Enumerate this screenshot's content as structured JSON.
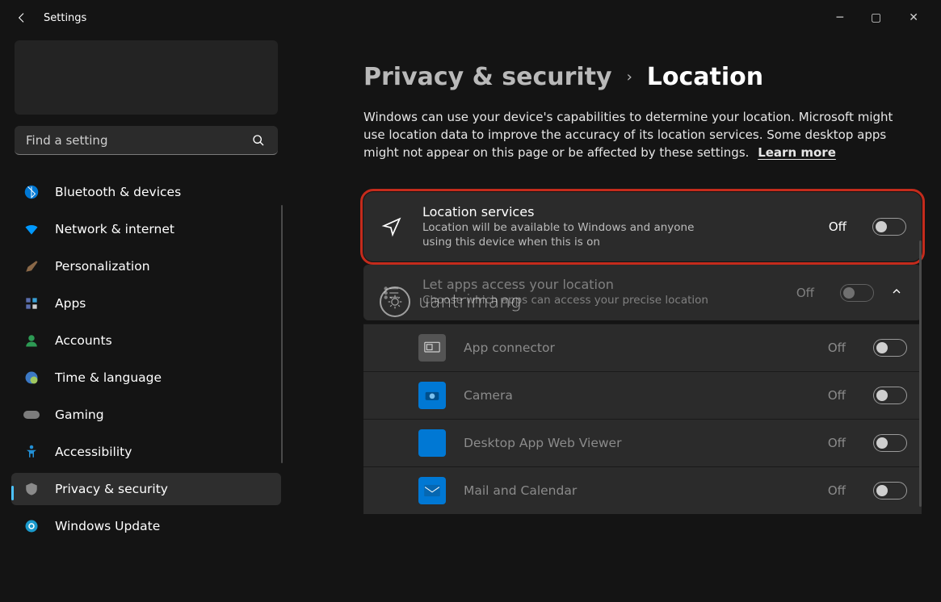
{
  "app_title": "Settings",
  "search_placeholder": "Find a setting",
  "sidebar": {
    "items": [
      {
        "label": "Bluetooth & devices"
      },
      {
        "label": "Network & internet"
      },
      {
        "label": "Personalization"
      },
      {
        "label": "Apps"
      },
      {
        "label": "Accounts"
      },
      {
        "label": "Time & language"
      },
      {
        "label": "Gaming"
      },
      {
        "label": "Accessibility"
      },
      {
        "label": "Privacy & security"
      },
      {
        "label": "Windows Update"
      }
    ]
  },
  "breadcrumb": {
    "parent": "Privacy & security",
    "current": "Location"
  },
  "description": "Windows can use your device's capabilities to determine your location. Microsoft might use location data to improve the accuracy of its location services. Some desktop apps might not appear on this page or be affected by these settings.",
  "learn_more": "Learn more",
  "cards": {
    "location_services": {
      "title": "Location services",
      "subtitle": "Location will be available to Windows and anyone using this device when this is on",
      "state": "Off"
    },
    "app_access": {
      "title": "Let apps access your location",
      "subtitle": "Choose which apps can access your precise location",
      "state": "Off"
    }
  },
  "apps": [
    {
      "name": "App connector",
      "state": "Off",
      "icon": "grey"
    },
    {
      "name": "Camera",
      "state": "Off",
      "icon": "blue"
    },
    {
      "name": "Desktop App Web Viewer",
      "state": "Off",
      "icon": "bluefill"
    },
    {
      "name": "Mail and Calendar",
      "state": "Off",
      "icon": "blue"
    }
  ],
  "watermark": "uantrimang"
}
